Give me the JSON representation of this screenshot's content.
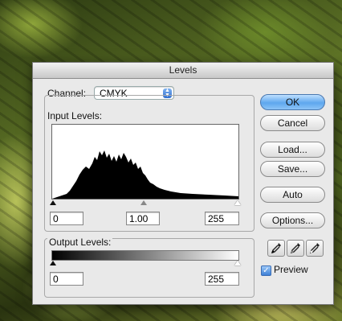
{
  "dialog": {
    "title": "Levels",
    "channel_label": "Channel:",
    "channel_value": "CMYK",
    "input_levels_label": "Input Levels:",
    "input_black": "0",
    "input_gamma": "1.00",
    "input_white": "255",
    "output_levels_label": "Output Levels:",
    "output_black": "0",
    "output_white": "255",
    "buttons": {
      "ok": "OK",
      "cancel": "Cancel",
      "load": "Load...",
      "save": "Save...",
      "auto": "Auto",
      "options": "Options..."
    },
    "preview_label": "Preview",
    "preview_checked": true
  },
  "colors": {
    "default_button": "#5ea7ee",
    "dialog_bg": "#e9e9e9"
  },
  "icons": [
    "black-eyedropper-icon",
    "gray-eyedropper-icon",
    "white-eyedropper-icon",
    "checkmark-icon"
  ]
}
